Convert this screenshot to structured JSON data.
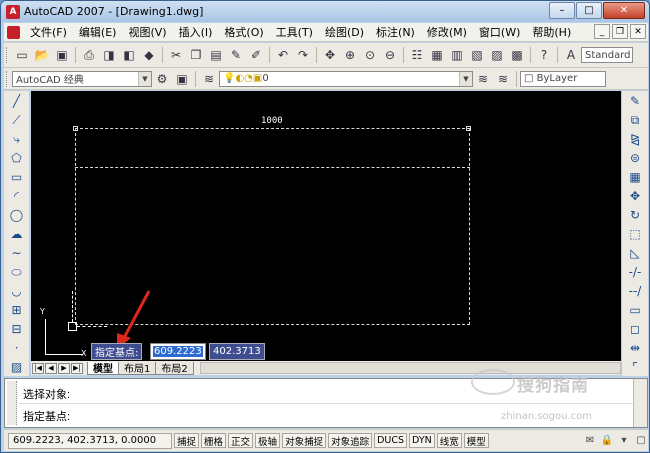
{
  "window": {
    "title": "AutoCAD 2007 - [Drawing1.dwg]",
    "app_icon_label": "A"
  },
  "win_controls": {
    "minimize": "–",
    "maximize": "□",
    "close": "✕"
  },
  "mdi_controls": {
    "minimize": "_",
    "restore": "❐",
    "close": "✕"
  },
  "menu": {
    "items": [
      "文件(F)",
      "编辑(E)",
      "视图(V)",
      "插入(I)",
      "格式(O)",
      "工具(T)",
      "绘图(D)",
      "标注(N)",
      "修改(M)",
      "窗口(W)",
      "帮助(H)"
    ]
  },
  "toolbar1": {
    "icons": [
      "new-icon",
      "open-icon",
      "save-icon",
      "print-icon",
      "preview-icon",
      "publish-icon",
      "3dprint-icon",
      "cut-icon",
      "copy-icon",
      "paste-icon",
      "matchprop-icon",
      "blockedit-icon",
      "undo-icon",
      "redo-icon",
      "pan-icon",
      "zoom-realtime-icon",
      "zoom-window-icon",
      "zoom-previous-icon",
      "properties-icon",
      "designcenter-icon",
      "toolpalette-icon",
      "sheetset-icon",
      "markup-icon",
      "calculator-icon",
      "help-icon",
      "textstyle-icon"
    ],
    "text_style": "Standard"
  },
  "toolbar2": {
    "workspace": "AutoCAD 经典",
    "layer": "0",
    "color": "ByLayer"
  },
  "canvas": {
    "dimension_text": "1000",
    "ucs_x": "X",
    "ucs_y": "Y"
  },
  "dynamic_input": {
    "prompt": "指定基点:",
    "x_value": "609.2223",
    "y_value": "402.3713"
  },
  "layout_tabs": [
    "模型",
    "布局1",
    "布局2"
  ],
  "nav_buttons": [
    "|◀",
    "◀",
    "▶",
    "▶|"
  ],
  "command": {
    "line1": "选择对象:",
    "line2": "指定基点:"
  },
  "watermark": {
    "text": "搜狗指南",
    "url": "zhinan.sogou.com"
  },
  "status": {
    "coords": "609.2223, 402.3713, 0.0000",
    "toggles": [
      "捕捉",
      "栅格",
      "正交",
      "极轴",
      "对象捕捉",
      "对象追踪",
      "DUCS",
      "DYN",
      "线宽",
      "模型"
    ]
  },
  "colors": {
    "canvas": "#000000",
    "title_bar": "#bcd3ea",
    "annotation_arrow": "#e0271e",
    "dynamic_input_bg": "#3e4d8f"
  }
}
